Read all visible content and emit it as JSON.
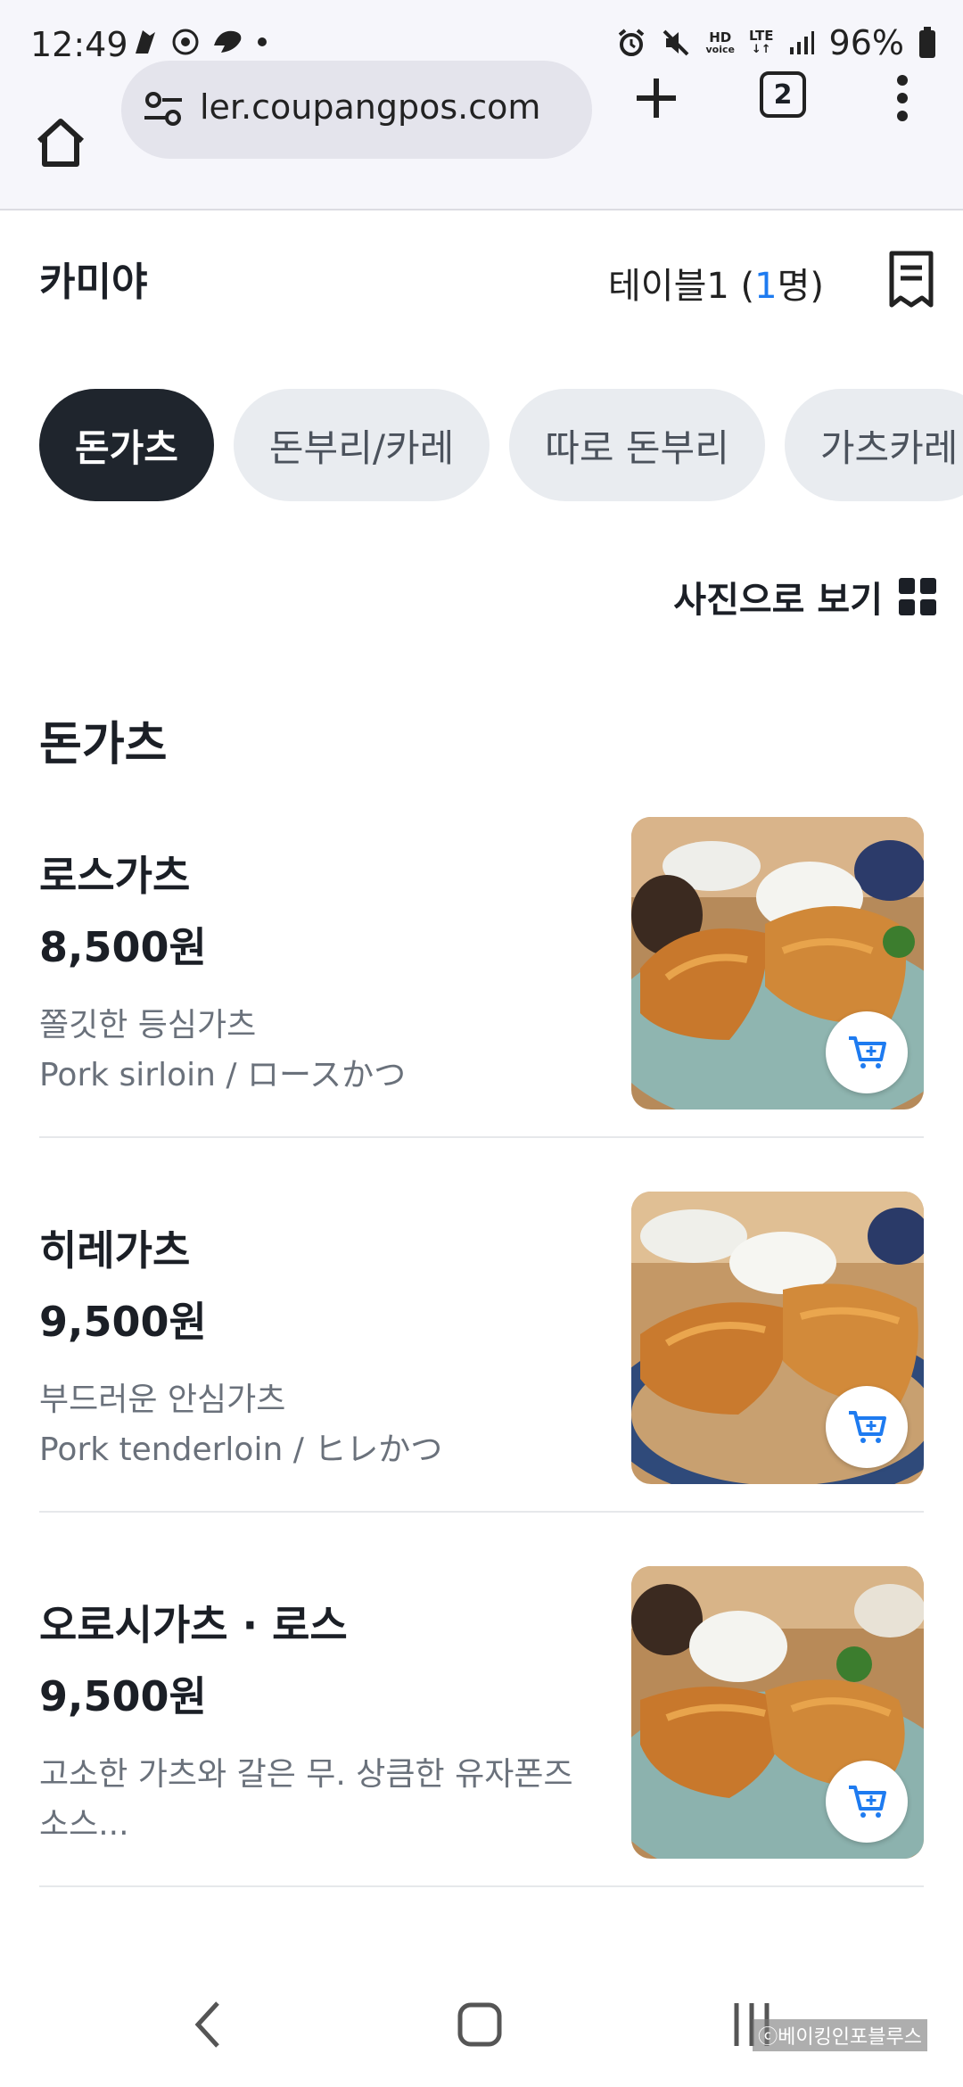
{
  "status_bar": {
    "time": "12:49",
    "battery": "96%",
    "hd_label": "HD",
    "voice_label": "voice",
    "lte_label": "LTE"
  },
  "browser": {
    "url": "ler.coupangpos.com",
    "tab_count": "2"
  },
  "header": {
    "store_name": "카미야",
    "table_prefix": "테이블1 (",
    "table_count": "1",
    "table_suffix": "명)"
  },
  "categories": [
    "돈가츠",
    "돈부리/카레",
    "따로 돈부리",
    "가츠카레"
  ],
  "view_toggle": {
    "label": "사진으로 보기"
  },
  "section": {
    "title": "돈가츠"
  },
  "items": [
    {
      "name": "로스가츠",
      "price": "8,500원",
      "desc_line1": "쫄깃한 등심가츠",
      "desc_line2": "Pork sirloin / ロースかつ"
    },
    {
      "name": "히레가츠",
      "price": "9,500원",
      "desc_line1": "부드러운 안심가츠",
      "desc_line2": "Pork tenderloin / ヒレかつ"
    },
    {
      "name": "오로시가츠 · 로스",
      "price": "9,500원",
      "desc_line1": "고소한 가츠와 갈은 무. 상큼한 유자폰즈",
      "desc_line2": "소스..."
    }
  ],
  "watermark": "ⓒ베이킹인포블루스",
  "colors": {
    "accent": "#1e7bf0",
    "chip_active": "#1f252d",
    "chip_inactive": "#e9ecf0"
  }
}
